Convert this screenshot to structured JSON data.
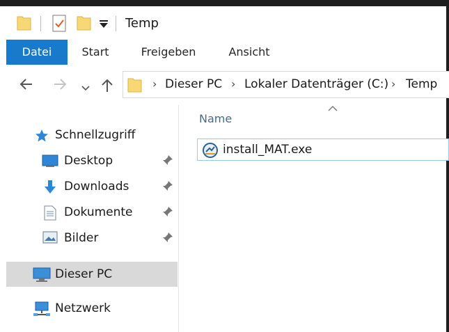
{
  "window": {
    "title": "Temp"
  },
  "ribbon": {
    "tabs": [
      {
        "label": "Datei"
      },
      {
        "label": "Start"
      },
      {
        "label": "Freigeben"
      },
      {
        "label": "Ansicht"
      }
    ]
  },
  "address": {
    "crumbs": [
      "Dieser PC",
      "Lokaler Datenträger (C:)",
      "Temp"
    ]
  },
  "nav": {
    "quick_access": "Schnellzugriff",
    "pinned": [
      {
        "label": "Desktop",
        "icon": "desktop-icon"
      },
      {
        "label": "Downloads",
        "icon": "downloads-icon"
      },
      {
        "label": "Dokumente",
        "icon": "documents-icon"
      },
      {
        "label": "Bilder",
        "icon": "pictures-icon"
      }
    ],
    "this_pc": "Dieser PC",
    "network": "Netzwerk"
  },
  "content": {
    "column_name": "Name",
    "files": [
      {
        "name": "install_MAT.exe",
        "icon": "installer-icon"
      }
    ]
  },
  "colors": {
    "accent": "#1979ca",
    "selection": "#d9d9d9",
    "file_focus": "#99c9ef"
  }
}
